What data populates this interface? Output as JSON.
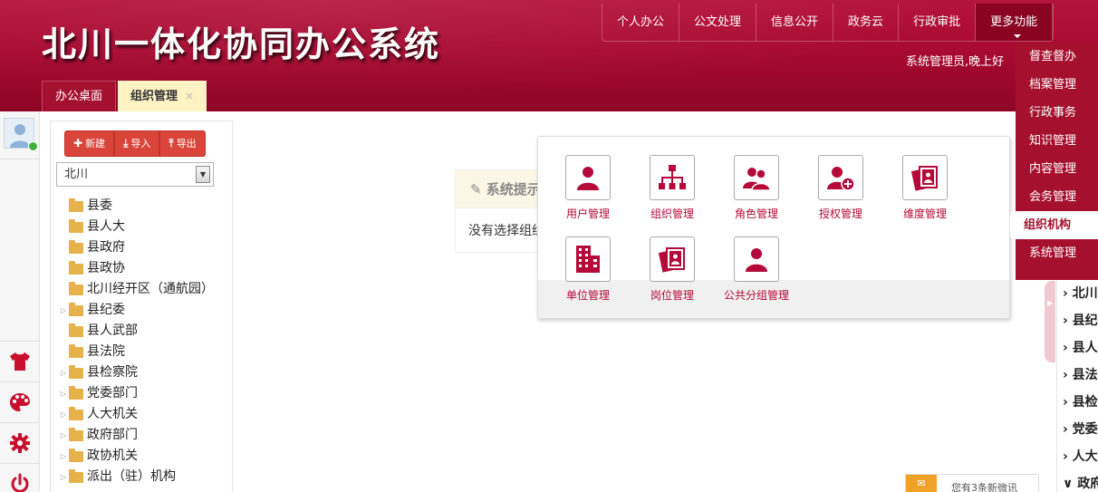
{
  "header": {
    "title": "北川一体化协同办公系统",
    "greeting": "系统管理员,晚上好"
  },
  "topnav": [
    {
      "label": "个人办公"
    },
    {
      "label": "公文处理"
    },
    {
      "label": "信息公开"
    },
    {
      "label": "政务云"
    },
    {
      "label": "行政审批"
    },
    {
      "label": "更多功能"
    }
  ],
  "tabs": [
    {
      "label": "办公桌面"
    },
    {
      "label": "组织管理",
      "close": "×"
    }
  ],
  "toolbar": {
    "new_label": "新建",
    "import_label": "导入",
    "export_label": "导出"
  },
  "org_select": {
    "value": "北川"
  },
  "tree": [
    {
      "label": "县委",
      "expandable": false
    },
    {
      "label": "县人大",
      "expandable": false
    },
    {
      "label": "县政府",
      "expandable": false
    },
    {
      "label": "县政协",
      "expandable": false
    },
    {
      "label": "北川经开区（通航园）",
      "expandable": false
    },
    {
      "label": "县纪委",
      "expandable": true
    },
    {
      "label": "县人武部",
      "expandable": false
    },
    {
      "label": "县法院",
      "expandable": false
    },
    {
      "label": "县检察院",
      "expandable": true
    },
    {
      "label": "党委部门",
      "expandable": true
    },
    {
      "label": "人大机关",
      "expandable": true
    },
    {
      "label": "政府部门",
      "expandable": true
    },
    {
      "label": "政协机关",
      "expandable": true
    },
    {
      "label": "派出（驻）机构",
      "expandable": true
    }
  ],
  "system_tip": {
    "title": "系统提示",
    "message": "没有选择组织"
  },
  "app_tiles": [
    {
      "label": "用户管理",
      "icon": "user-icon"
    },
    {
      "label": "组织管理",
      "icon": "org-chart-icon"
    },
    {
      "label": "角色管理",
      "icon": "roles-icon"
    },
    {
      "label": "授权管理",
      "icon": "user-add-icon"
    },
    {
      "label": "维度管理",
      "icon": "photo-stack-icon"
    },
    {
      "label": "单位管理",
      "icon": "building-icon"
    },
    {
      "label": "岗位管理",
      "icon": "photo-stack-icon"
    },
    {
      "label": "公共分组管理",
      "icon": "user-icon"
    }
  ],
  "dropdown": [
    {
      "label": "督查督办"
    },
    {
      "label": "档案管理"
    },
    {
      "label": "行政事务"
    },
    {
      "label": "知识管理"
    },
    {
      "label": "内容管理"
    },
    {
      "label": "会务管理"
    },
    {
      "label": "组织机构",
      "highlight": true
    },
    {
      "label": "系统管理"
    }
  ],
  "right_strip": [
    {
      "label": "北川"
    },
    {
      "label": "县纪委"
    },
    {
      "label": "县人武部"
    },
    {
      "label": "县法院"
    },
    {
      "label": "县检察院"
    },
    {
      "label": "党委部门"
    },
    {
      "label": "人大机关"
    },
    {
      "label": "政府部门"
    }
  ],
  "notification": {
    "text": "您有3条新微讯"
  },
  "colors": {
    "brand": "#a80a31",
    "accent_button": "#d9453a",
    "tile_icon": "#b5093a"
  }
}
